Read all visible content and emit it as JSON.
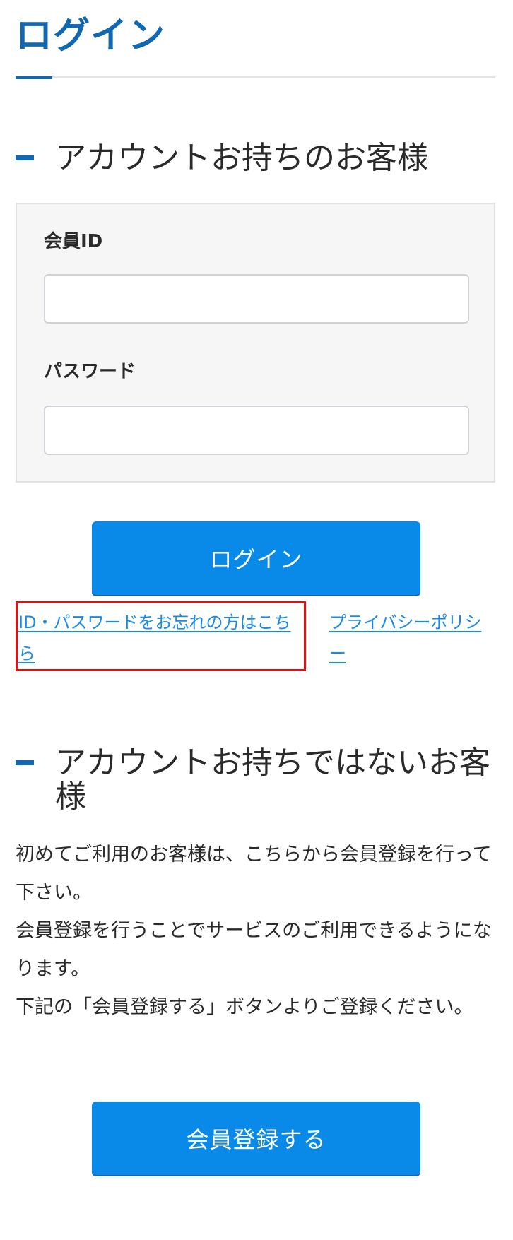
{
  "page": {
    "title": "ログイン"
  },
  "account_section": {
    "heading": "アカウントお持ちのお客様",
    "member_id_label": "会員ID",
    "member_id_value": "",
    "password_label": "パスワード",
    "password_value": "",
    "login_button": "ログイン",
    "forgot_link": "ID・パスワードをお忘れの方はこちら",
    "privacy_link": "プライバシーポリシー"
  },
  "no_account_section": {
    "heading": "アカウントお持ちではないお客様",
    "paragraphs": [
      "初めてご利用のお客様は、こちらから会員登録を行って下さい。",
      "会員登録を行うことでサービスのご利用できるようになります。",
      "下記の「会員登録する」ボタンよりご登録ください。"
    ],
    "register_button": "会員登録する"
  },
  "colors": {
    "brand_blue": "#1167b1",
    "button_blue": "#0989e8",
    "link_blue": "#1a8ae6",
    "highlight_red": "#e01010"
  }
}
